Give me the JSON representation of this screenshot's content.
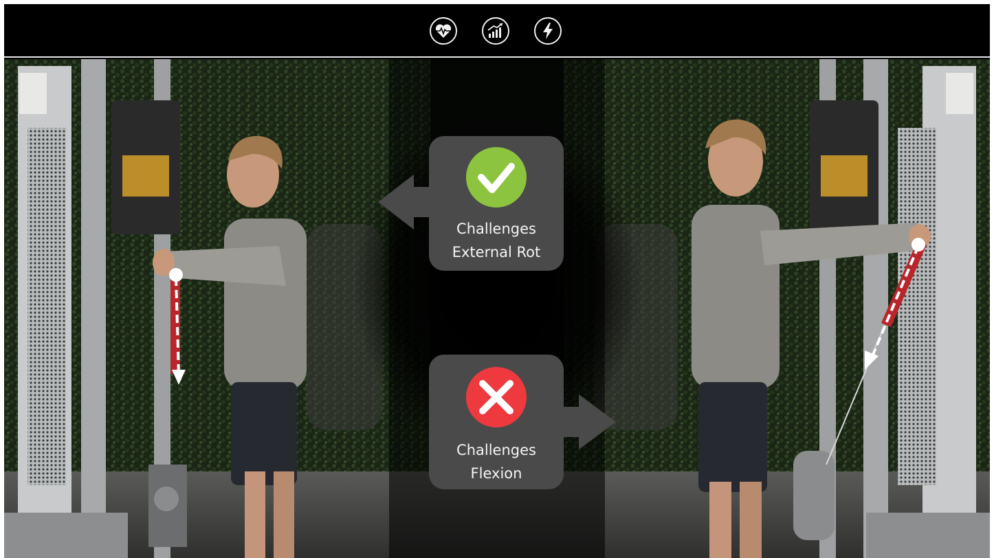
{
  "header": {
    "icons": [
      "heart-rate-icon",
      "growth-chart-icon",
      "lightning-bolt-icon"
    ]
  },
  "callouts": {
    "top": {
      "line1": "Challenges",
      "line2": "External Rot",
      "status_icon": "checkmark-icon",
      "status_color": "#8dc43f"
    },
    "bottom": {
      "line1": "Challenges",
      "line2": "Flexion",
      "status_icon": "cross-icon",
      "status_color": "#ee3a3f"
    }
  },
  "colors": {
    "callout_bg": "#4a4a4a",
    "background": "#000000",
    "divider": "#e8e8e8",
    "band_red": "#b8252a"
  }
}
